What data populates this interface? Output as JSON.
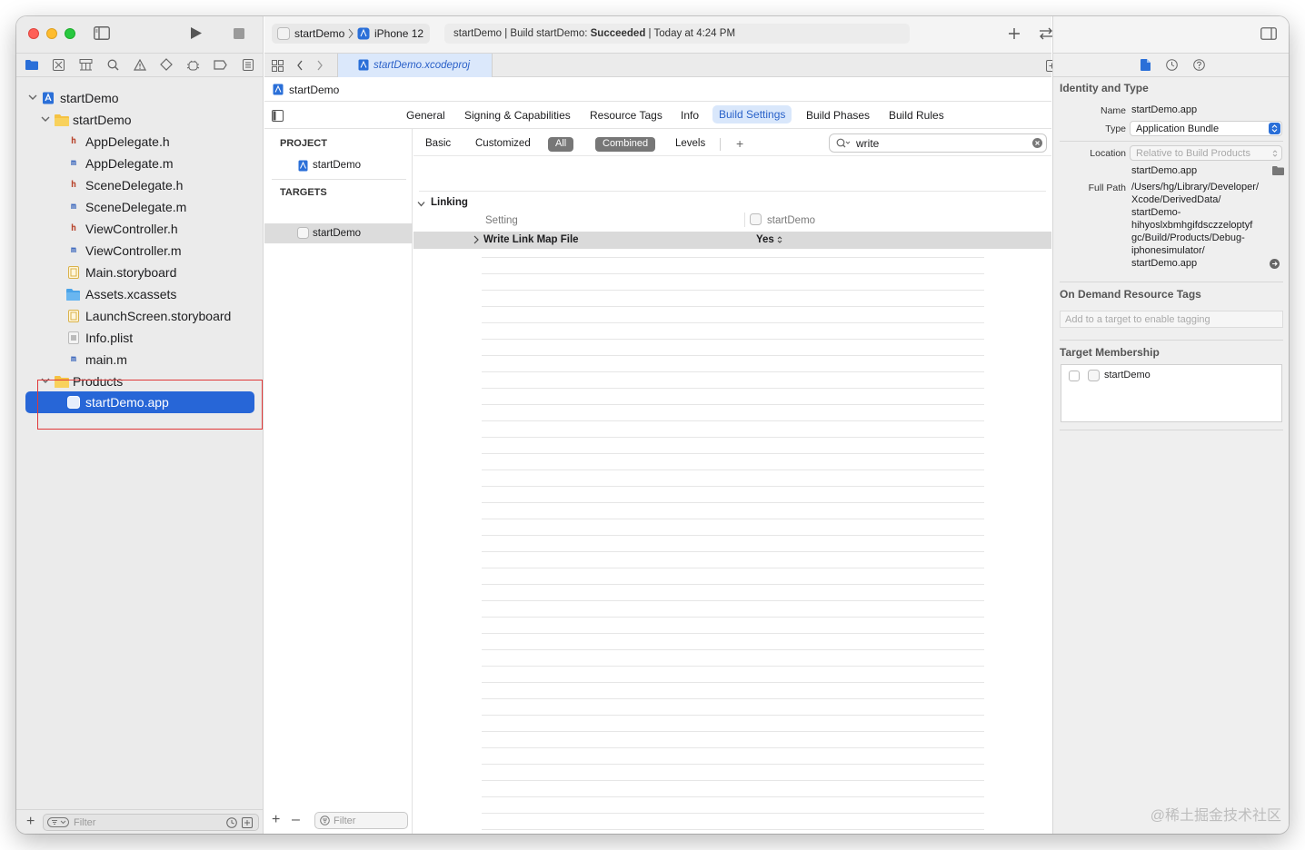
{
  "colors": {
    "selection": "#2766d7",
    "highlight_box": "#e03838",
    "accent": "#2a62c9"
  },
  "navigator": {
    "tree": [
      {
        "label": "startDemo",
        "icon": "xcodeproj-icon",
        "depth": 0,
        "disclosure": "expanded"
      },
      {
        "label": "startDemo",
        "icon": "folder-icon",
        "depth": 1,
        "disclosure": "expanded"
      },
      {
        "label": "AppDelegate.h",
        "icon": "h",
        "depth": 2
      },
      {
        "label": "AppDelegate.m",
        "icon": "m",
        "depth": 2
      },
      {
        "label": "SceneDelegate.h",
        "icon": "h",
        "depth": 2
      },
      {
        "label": "SceneDelegate.m",
        "icon": "m",
        "depth": 2
      },
      {
        "label": "ViewController.h",
        "icon": "h",
        "depth": 2
      },
      {
        "label": "ViewController.m",
        "icon": "m",
        "depth": 2
      },
      {
        "label": "Main.storyboard",
        "icon": "storyboard-icon",
        "depth": 2
      },
      {
        "label": "Assets.xcassets",
        "icon": "assets-icon",
        "depth": 2
      },
      {
        "label": "LaunchScreen.storyboard",
        "icon": "storyboard-icon",
        "depth": 2
      },
      {
        "label": "Info.plist",
        "icon": "plist-icon",
        "depth": 2
      },
      {
        "label": "main.m",
        "icon": "m",
        "depth": 2
      },
      {
        "label": "Products",
        "icon": "folder-icon",
        "depth": 1,
        "disclosure": "expanded"
      },
      {
        "label": "startDemo.app",
        "icon": "app-icon",
        "depth": 2,
        "selected": true
      }
    ],
    "filter_placeholder": "Filter"
  },
  "toolbar": {
    "scheme": "startDemo",
    "device": "iPhone 12",
    "status_prefix": "startDemo | Build startDemo: ",
    "status_bold": "Succeeded",
    "status_suffix": " | Today at 4:24 PM"
  },
  "editor": {
    "tab_title": "startDemo.xcodeproj",
    "jump_bar": "startDemo",
    "tabs": [
      "General",
      "Signing & Capabilities",
      "Resource Tags",
      "Info",
      "Build Settings",
      "Build Phases",
      "Build Rules"
    ],
    "selected_tab": "Build Settings",
    "project_header": "PROJECT",
    "project_item": "startDemo",
    "targets_header": "TARGETS",
    "target_item": "startDemo",
    "filter_placeholder": "Filter",
    "build_settings": {
      "basic": "Basic",
      "customized": "Customized",
      "all": "All",
      "combined": "Combined",
      "levels": "Levels",
      "add": "+",
      "search_value": "write",
      "group": "Linking",
      "col_setting": "Setting",
      "col_target": "startDemo",
      "row_name": "Write Link Map File",
      "row_value": "Yes"
    }
  },
  "inspector": {
    "identity_title": "Identity and Type",
    "name_label": "Name",
    "name_value": "startDemo.app",
    "type_label": "Type",
    "type_value": "Application Bundle",
    "location_label": "Location",
    "location_value": "Relative to Build Products",
    "location_file": "startDemo.app",
    "fullpath_label": "Full Path",
    "fullpath_lines": [
      "/Users/hg/Library/Developer/",
      "Xcode/DerivedData/",
      "startDemo-",
      "hihyoslxbmhgifdsczzeloptyf",
      "gc/Build/Products/Debug-",
      "iphonesimulator/",
      "startDemo.app"
    ],
    "odr_title": "On Demand Resource Tags",
    "odr_placeholder": "Add to a target to enable tagging",
    "membership_title": "Target Membership",
    "membership_target": "startDemo"
  },
  "watermark": "@稀土掘金技术社区"
}
